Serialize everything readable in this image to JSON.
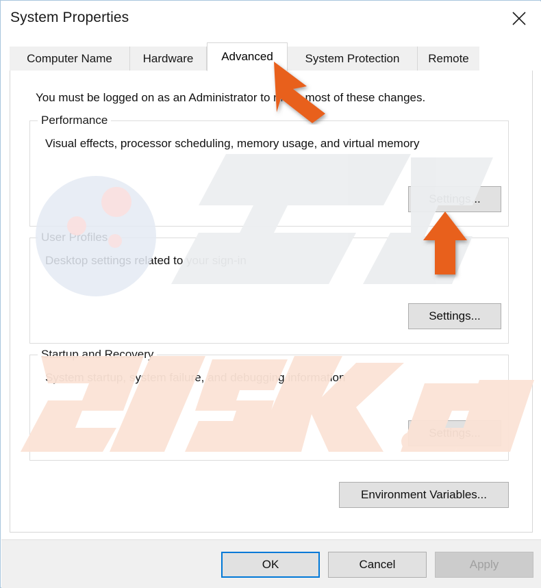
{
  "window": {
    "title": "System Properties",
    "close_icon": "close-icon"
  },
  "tabs": [
    {
      "label": "Computer Name",
      "active": false
    },
    {
      "label": "Hardware",
      "active": false
    },
    {
      "label": "Advanced",
      "active": true
    },
    {
      "label": "System Protection",
      "active": false
    },
    {
      "label": "Remote",
      "active": false
    }
  ],
  "content": {
    "admin_note": "You must be logged on as an Administrator to make most of these changes.",
    "groups": [
      {
        "legend": "Performance",
        "description": "Visual effects, processor scheduling, memory usage, and virtual memory",
        "button": "Settings..."
      },
      {
        "legend": "User Profiles",
        "description": "Desktop settings related to your sign-in",
        "button": "Settings..."
      },
      {
        "legend": "Startup and Recovery",
        "description": "System startup, system failure, and debugging information",
        "button": "Settings..."
      }
    ],
    "environment_variables_button": "Environment Variables..."
  },
  "footer": {
    "ok": "OK",
    "cancel": "Cancel",
    "apply": "Apply"
  },
  "annotations": {
    "arrow_color": "#e8611c",
    "arrow_tab": "arrow-pointing-to-advanced-tab",
    "arrow_settings": "arrow-pointing-to-performance-settings-button"
  },
  "watermark": {
    "brand": "PC",
    "domain": "risk.com",
    "brand_color": "#e6ebf2",
    "domain_color": "#fbe7dc"
  }
}
